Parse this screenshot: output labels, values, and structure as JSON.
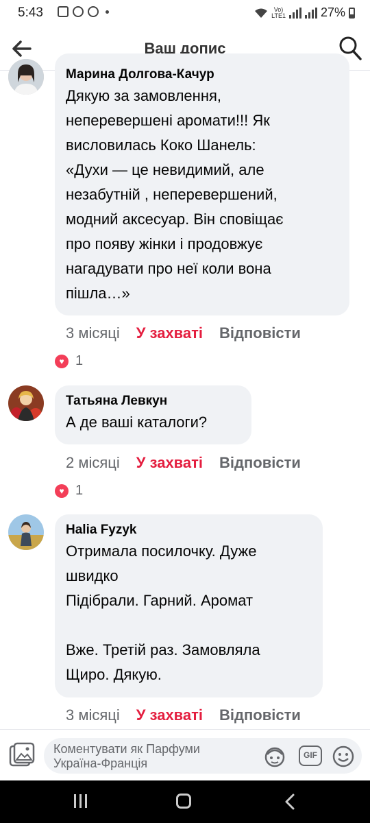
{
  "status_bar": {
    "time": "5:43",
    "volte_top": "Vo)",
    "volte_bottom": "LTE1",
    "battery": "27%"
  },
  "header": {
    "title": "Ваш допис",
    "back_icon": "arrow-left-icon",
    "search_icon": "search-icon"
  },
  "comments": [
    {
      "author": "Марина Долгова-Качур",
      "text": "Дякую за замовлення,\nнеперевершені аромати!!! Як\nвисловилась Коко Шанель:\n«Духи — це невидимий, але\nнезабутній , неперевершений,\nмодний аксесуар. Він сповіщає\nпро появу жінки і продовжує\nнагадувати про неї коли вона\nпішла…»",
      "time": "3 місяці",
      "like_label": "У захваті",
      "reply_label": "Відповісти",
      "reaction_count": "1"
    },
    {
      "author": "Татьяна Левкун",
      "text": "А де ваші каталоги?",
      "time": "2 місяці",
      "like_label": "У захваті",
      "reply_label": "Відповісти",
      "reaction_count": "1"
    },
    {
      "author": "Halia Fyzyk",
      "text": "Отримала посилочку. Дуже\nшвидко\nПідібрали. Гарний. Аромат\n\nВже. Третій раз. Замовляла\nЩиро. Дякую.",
      "time": "3 місяці",
      "like_label": "У захваті",
      "reply_label": "Відповісти"
    }
  ],
  "composer": {
    "placeholder": "Коментувати як Парфуми Україна-Франція",
    "gif_label": "GIF"
  },
  "colors": {
    "accent_like": "#e41e3f",
    "bubble_bg": "#f0f2f5",
    "meta_text": "#65676b",
    "heart": "#f33e58"
  }
}
